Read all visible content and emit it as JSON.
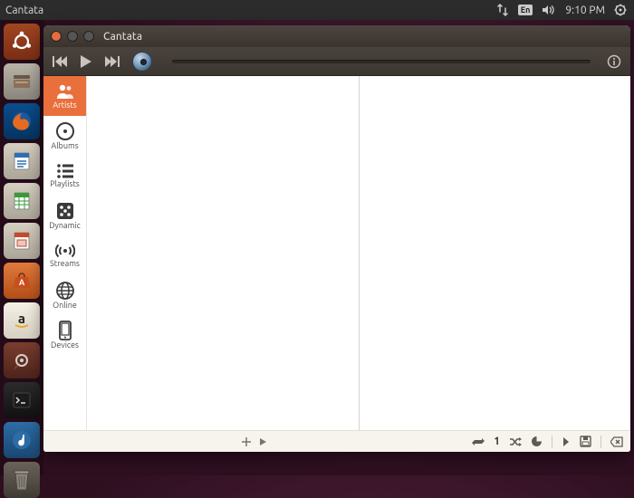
{
  "menubar": {
    "appname": "Cantata",
    "lang": "En",
    "time": "9:10 PM"
  },
  "launcher": {
    "items": [
      {
        "name": "dash"
      },
      {
        "name": "files"
      },
      {
        "name": "firefox"
      },
      {
        "name": "writer"
      },
      {
        "name": "calc"
      },
      {
        "name": "impress"
      },
      {
        "name": "software"
      },
      {
        "name": "amazon"
      },
      {
        "name": "settings"
      },
      {
        "name": "terminal"
      },
      {
        "name": "cantata"
      }
    ]
  },
  "window": {
    "title": "Cantata"
  },
  "sidebar": {
    "items": [
      {
        "key": "artists",
        "label": "Artists"
      },
      {
        "key": "albums",
        "label": "Albums"
      },
      {
        "key": "playlists",
        "label": "Playlists"
      },
      {
        "key": "dynamic",
        "label": "Dynamic"
      },
      {
        "key": "streams",
        "label": "Streams"
      },
      {
        "key": "online",
        "label": "Online"
      },
      {
        "key": "devices",
        "label": "Devices"
      }
    ]
  },
  "status": {
    "single_count": "1"
  }
}
